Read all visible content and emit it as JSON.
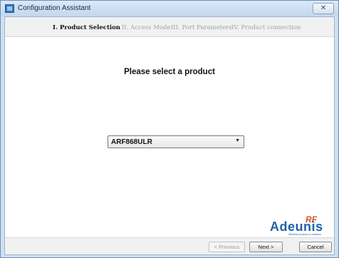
{
  "window": {
    "title": "Configuration Assistant",
    "close_glyph": "✕"
  },
  "steps": [
    {
      "label": "I. Product Selection",
      "active": true
    },
    {
      "label": "II. Access Mode",
      "active": false
    },
    {
      "label": "III. Port Parameters",
      "active": false
    },
    {
      "label": "IV. Product connection",
      "active": false
    }
  ],
  "main": {
    "heading": "Please select a product",
    "product_select": {
      "value": "ARF868ULR",
      "arrow": "▼"
    }
  },
  "logo": {
    "rf": "RF",
    "name": "Adeunis",
    "tagline": "Wireless products & solutions"
  },
  "buttons": {
    "previous": "< Previous",
    "next": "Next >",
    "cancel": "Cancel"
  }
}
